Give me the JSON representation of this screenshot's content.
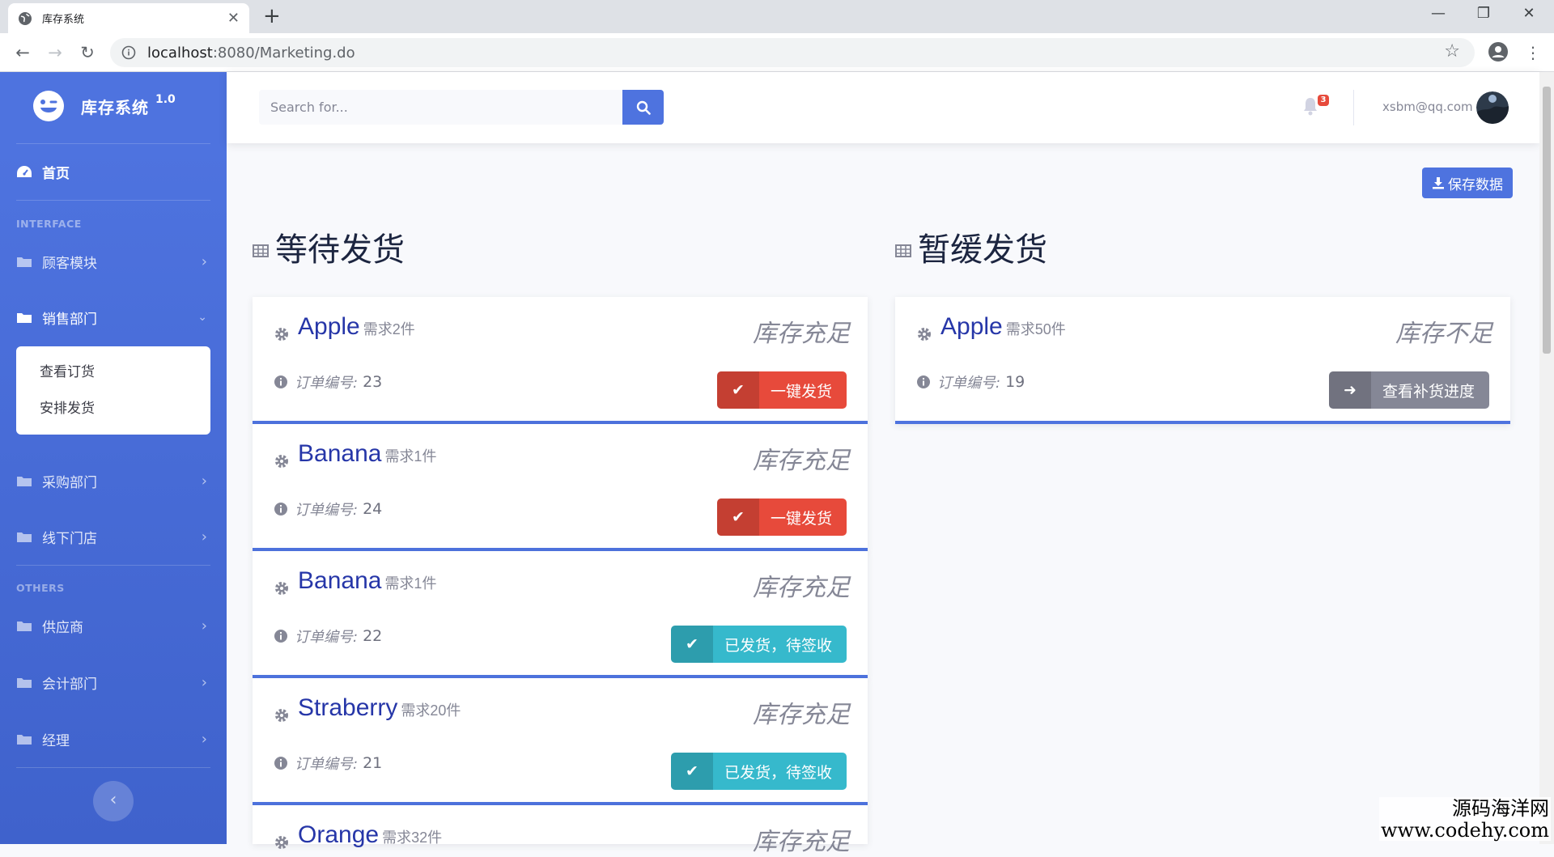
{
  "browser": {
    "tab_title": "库存系统",
    "new_tab": "+",
    "url_host": "localhost",
    "url_rest": ":8080/Marketing.do"
  },
  "sidebar": {
    "brand_name": "库存系统",
    "brand_version": "1.0",
    "home_label": "首页",
    "section_interface": "INTERFACE",
    "section_others": "OTHERS",
    "items": [
      {
        "label": "顾客模块"
      },
      {
        "label": "销售部门"
      },
      {
        "label": "采购部门"
      },
      {
        "label": "线下门店"
      },
      {
        "label": "供应商"
      },
      {
        "label": "会计部门"
      },
      {
        "label": "经理"
      }
    ],
    "submenu": [
      "查看订货",
      "安排发货"
    ]
  },
  "topbar": {
    "search_placeholder": "Search for...",
    "alert_count": "3",
    "user_email": "xsbm@qq.com"
  },
  "actions": {
    "save_label": "保存数据"
  },
  "colors": {
    "primary": "#4e73df",
    "danger": "#e74a3b",
    "info": "#36b9cc",
    "secondary": "#858796"
  },
  "pending": {
    "title": "等待发货",
    "order_label": "订单编号:",
    "cards": [
      {
        "product": "Apple",
        "need": "需求2件",
        "stock": "库存充足",
        "order": "23",
        "action": "一键发货"
      },
      {
        "product": "Banana",
        "need": "需求1件",
        "stock": "库存充足",
        "order": "24",
        "action": "一键发货"
      },
      {
        "product": "Banana",
        "need": "需求1件",
        "stock": "库存充足",
        "order": "22",
        "action": "已发货，待签收"
      },
      {
        "product": "Straberry",
        "need": "需求20件",
        "stock": "库存充足",
        "order": "21",
        "action": "已发货，待签收"
      },
      {
        "product": "Orange",
        "need": "需求32件",
        "stock": "库存充足"
      }
    ]
  },
  "delayed": {
    "title": "暂缓发货",
    "order_label": "订单编号:",
    "cards": [
      {
        "product": "Apple",
        "need": "需求50件",
        "stock": "库存不足",
        "order": "19",
        "action": "查看补货进度"
      }
    ]
  },
  "watermark": {
    "line1": "源码海洋网",
    "line2": "www.codehy.com"
  }
}
